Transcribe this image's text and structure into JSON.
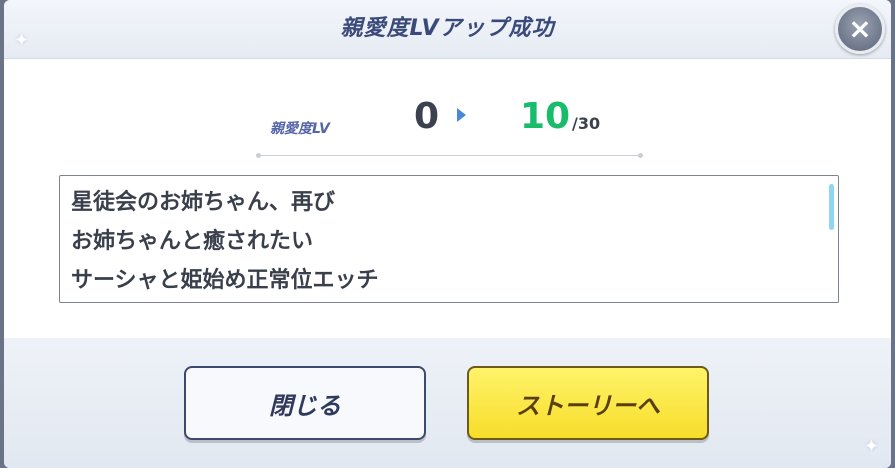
{
  "dialog": {
    "title": "親愛度LVアップ成功",
    "close_icon": "×"
  },
  "level": {
    "label": "親愛度LV",
    "from": "0",
    "to": "10",
    "max": "/30"
  },
  "stories": [
    "星徒会のお姉ちゃん、再び",
    "お姉ちゃんと癒されたい",
    "サーシャと姫始め正常位エッチ"
  ],
  "buttons": {
    "close_label": "閉じる",
    "story_label": "ストーリーへ"
  },
  "colors": {
    "title": "#3a4a7a",
    "level_to": "#19bc6a",
    "story_button": "#f7dd2a"
  }
}
